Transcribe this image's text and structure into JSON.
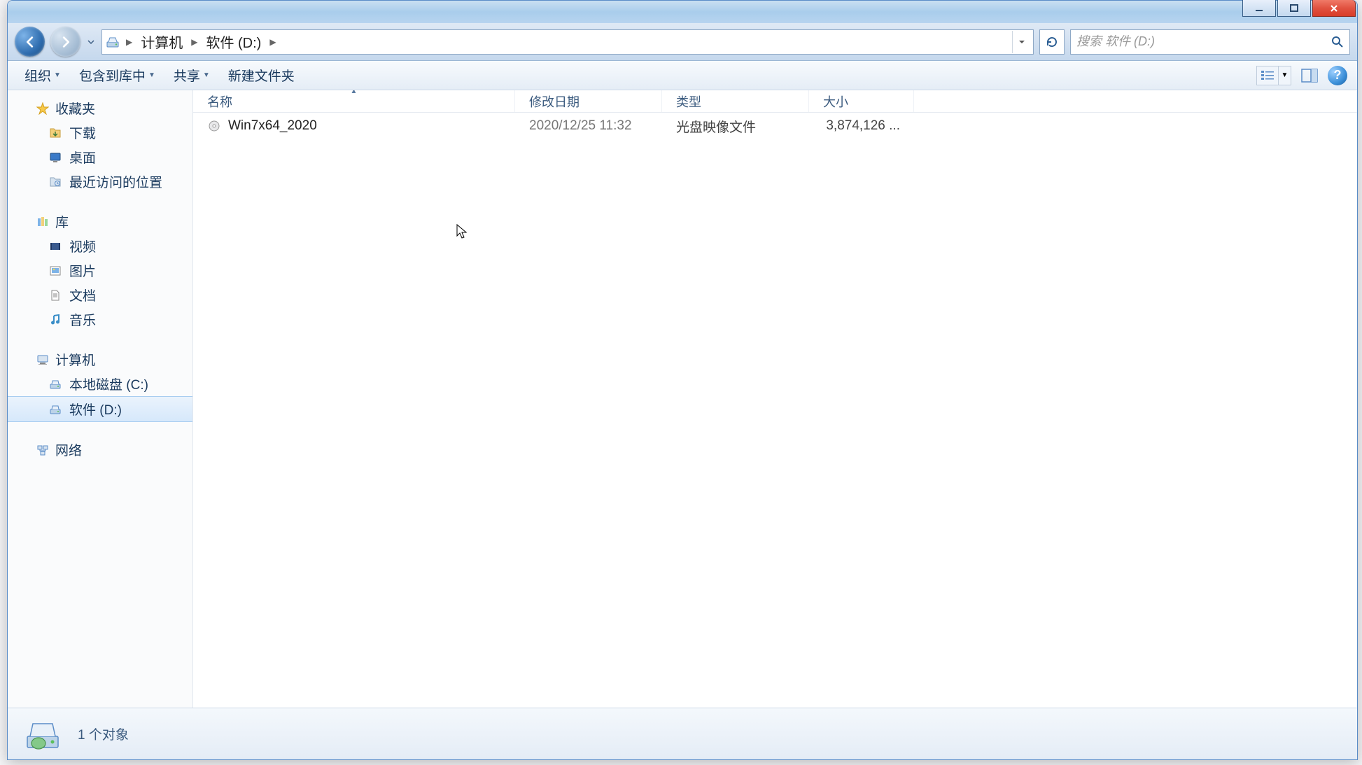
{
  "breadcrumb": {
    "seg1": "计算机",
    "seg2": "软件 (D:)"
  },
  "search": {
    "placeholder": "搜索 软件 (D:)"
  },
  "toolbar": {
    "organize": "组织",
    "include": "包含到库中",
    "share": "共享",
    "new_folder": "新建文件夹"
  },
  "columns": {
    "name": "名称",
    "date": "修改日期",
    "type": "类型",
    "size": "大小"
  },
  "files": [
    {
      "name": "Win7x64_2020",
      "date": "2020/12/25 11:32",
      "type": "光盘映像文件",
      "size": "3,874,126 ..."
    }
  ],
  "sidebar": {
    "favorites": {
      "label": "收藏夹",
      "items": [
        {
          "label": "下载"
        },
        {
          "label": "桌面"
        },
        {
          "label": "最近访问的位置"
        }
      ]
    },
    "libraries": {
      "label": "库",
      "items": [
        {
          "label": "视频"
        },
        {
          "label": "图片"
        },
        {
          "label": "文档"
        },
        {
          "label": "音乐"
        }
      ]
    },
    "computer": {
      "label": "计算机",
      "items": [
        {
          "label": "本地磁盘 (C:)"
        },
        {
          "label": "软件 (D:)"
        }
      ]
    },
    "network": {
      "label": "网络"
    }
  },
  "status": {
    "text": "1 个对象"
  }
}
